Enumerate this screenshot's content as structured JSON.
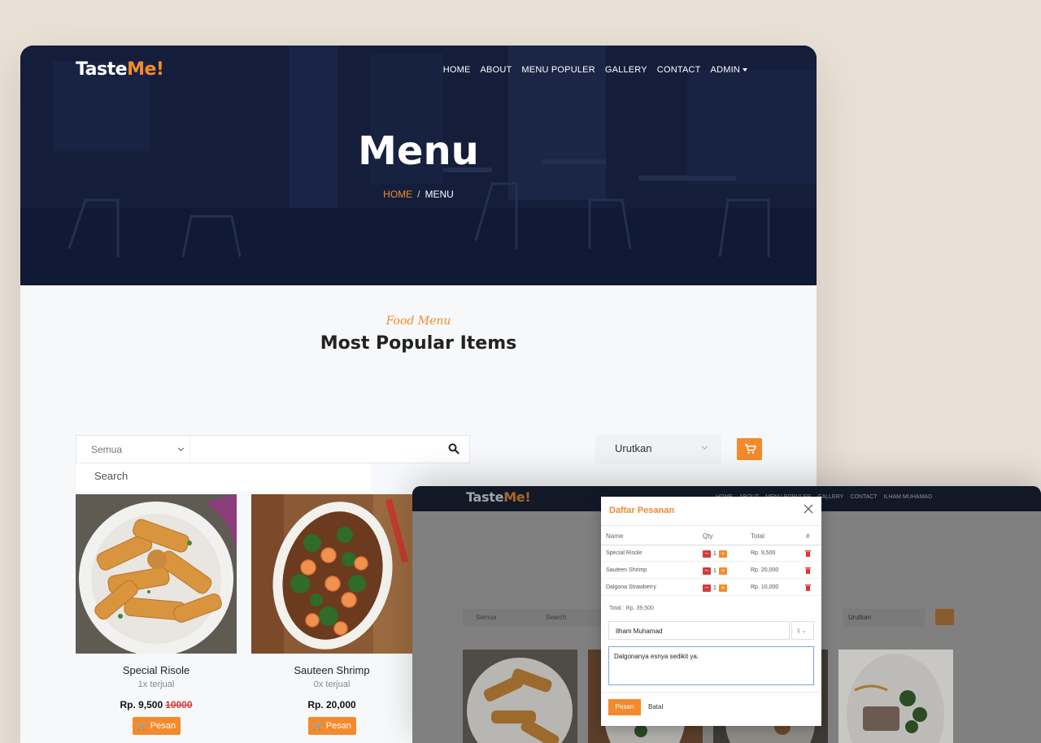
{
  "main": {
    "logo": {
      "text": "Taste",
      "accent": "Me!"
    },
    "nav": [
      {
        "label": "HOME"
      },
      {
        "label": "ABOUT"
      },
      {
        "label": "MENU POPULER"
      },
      {
        "label": "GALLERY"
      },
      {
        "label": "CONTACT"
      },
      {
        "label": "ADMIN"
      }
    ],
    "hero": {
      "title": "Menu",
      "breadcrumb": {
        "home": "HOME",
        "sep": "/",
        "current": "MENU"
      }
    },
    "section": {
      "subtitle": "Food Menu",
      "title": "Most Popular Items"
    },
    "filters": {
      "category_selected": "Semua",
      "search_dropdown_option": "Search",
      "sort_label": "Urutkan"
    },
    "products": [
      {
        "name": "Special Risole",
        "sold": "1x terjual",
        "price": "Rp. 9,500",
        "old_price": "10000",
        "button": "Pesan"
      },
      {
        "name": "Sauteen Shrimp",
        "sold": "0x terjual",
        "price": "Rp. 20,000",
        "old_price": "",
        "button": "Pesan"
      }
    ]
  },
  "secondary": {
    "logo": {
      "text": "Taste",
      "accent": "Me!"
    },
    "nav": [
      "HOME",
      "ABOUT",
      "MENU POPULER",
      "GALLERY",
      "CONTACT",
      "ILHAM MUHAMAD"
    ],
    "filters": {
      "category_selected": "Semua",
      "search_placeholder": "Search",
      "sort_label": "Urutkan"
    }
  },
  "modal": {
    "title": "Daftar Pesanan",
    "headers": {
      "name": "Name",
      "qty": "Qty",
      "total": "Total",
      "hash": "#"
    },
    "rows": [
      {
        "name": "Special Risole",
        "qty": "1",
        "total": "Rp. 9,500"
      },
      {
        "name": "Sauteen Shrimp",
        "qty": "1",
        "total": "Rp. 20,000"
      },
      {
        "name": "Dalgona Strawberry",
        "qty": "1",
        "total": "Rp. 10,000"
      }
    ],
    "total": "Total : Rp. 39,500",
    "customer_name": "Ilham Muhamad",
    "qty_select": "1",
    "note": "Dalgonanya esnya sedikit ya.",
    "pesan": "Pesan",
    "batal": "Batal"
  },
  "colors": {
    "accent": "#f48a2b",
    "hero_bg": "#17203d",
    "danger": "#d6383a"
  },
  "icons": [
    "search-icon",
    "cart-icon",
    "close-icon",
    "trash-icon",
    "chevron-down-icon"
  ]
}
